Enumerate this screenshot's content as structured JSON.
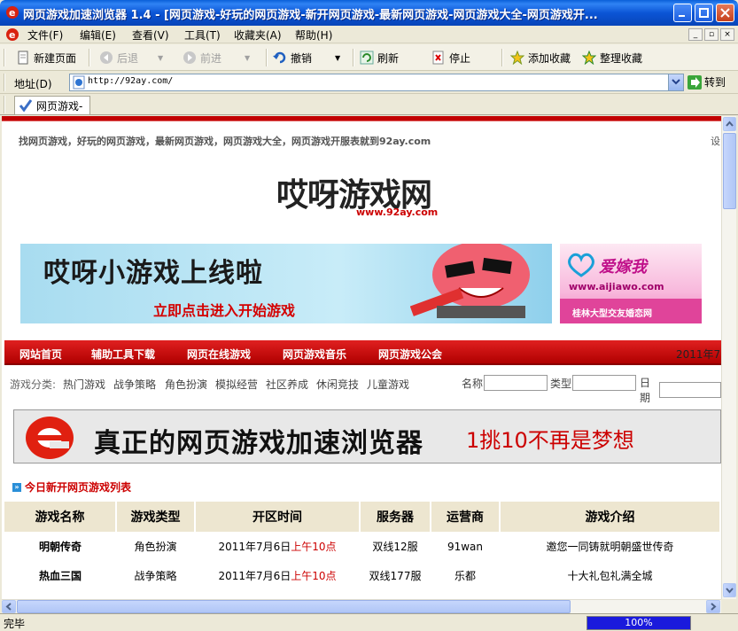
{
  "window": {
    "title": "网页游戏加速浏览器 1.4 - [网页游戏-好玩的网页游戏-新开网页游戏-最新网页游戏-网页游戏大全-网页游戏开..."
  },
  "menu": [
    "文件(F)",
    "编辑(E)",
    "查看(V)",
    "工具(T)",
    "收藏夹(A)",
    "帮助(H)"
  ],
  "toolbar": {
    "new_page": "新建页面",
    "back": "后退",
    "forward": "前进",
    "undo": "撤销",
    "refresh": "刷新",
    "stop": "停止",
    "add_favorite": "添加收藏",
    "organize_favorites": "整理收藏"
  },
  "address": {
    "label": "地址(D)",
    "url": "http://92ay.com/",
    "go_label": "转到"
  },
  "tabs": [
    {
      "label": "网页游戏-"
    }
  ],
  "page": {
    "slogan": "找网页游戏，好玩的网页游戏，最新网页游戏，网页游戏大全，网页游戏开服表就到92ay.com",
    "settings_link": "设",
    "logo_text": "哎呀游戏网",
    "logo_url": "www.92ay.com",
    "banner1": {
      "title": "哎呀小游戏上线啦",
      "subtitle": "立即点击进入开始游戏"
    },
    "banner2": {
      "title": "爱嫁我",
      "url": "www.aijiawo.com",
      "caption": "桂林大型交友婚恋网"
    },
    "nav": [
      "网站首页",
      "辅助工具下载",
      "网页在线游戏",
      "网页游戏音乐",
      "网页游戏公会"
    ],
    "nav_date": "2011年7",
    "category_label": "游戏分类:",
    "categories": [
      "热门游戏",
      "战争策略",
      "角色扮演",
      "模拟经营",
      "社区养成",
      "休闲竞技",
      "儿童游戏"
    ],
    "search": {
      "name_label": "名称",
      "type_label": "类型",
      "date_label": "日期"
    },
    "big_banner": {
      "title": "真正的网页游戏加速浏览器",
      "subtitle": "1挑10不再是梦想"
    },
    "list_heading": "今日新开网页游戏列表",
    "table": {
      "headers": [
        "游戏名称",
        "游戏类型",
        "开区时间",
        "服务器",
        "运营商",
        "游戏介绍"
      ],
      "rows": [
        {
          "name": "明朝传奇",
          "type": "角色扮演",
          "date": "2011年7月6日",
          "time": "上午10点",
          "server": "双线12服",
          "operator": "91wan",
          "intro": "邀您一同铸就明朝盛世传奇"
        },
        {
          "name": "热血三国",
          "type": "战争策略",
          "date": "2011年7月6日",
          "time": "上午10点",
          "server": "双线177服",
          "operator": "乐都",
          "intro": "十大礼包礼满全城"
        }
      ]
    }
  },
  "status": {
    "text": "完毕",
    "progress_label": "100%",
    "progress": 1.0
  },
  "colors": {
    "title_bar": "#0b55d6",
    "nav_red": "#c00000",
    "accent_red": "#cc0000"
  }
}
